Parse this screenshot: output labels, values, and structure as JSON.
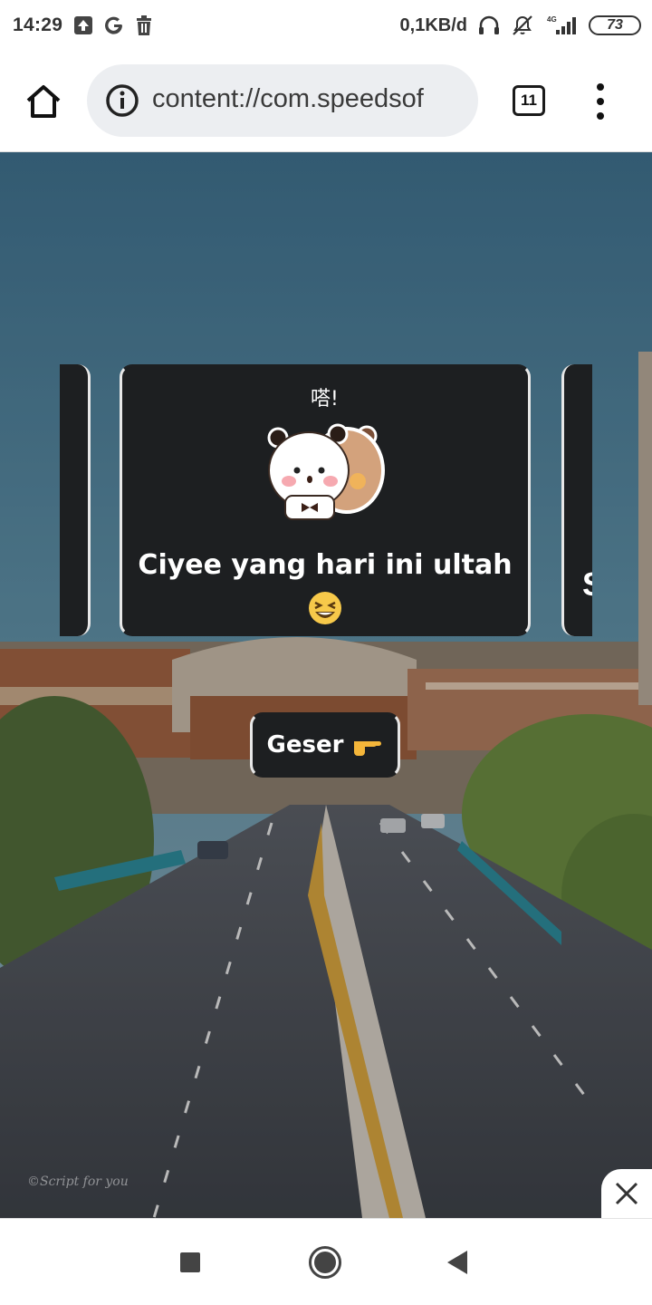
{
  "status_bar": {
    "time": "14:29",
    "left_icons": [
      "upload-icon",
      "google-icon",
      "trash-icon"
    ],
    "net_speed": "0,1KB/d",
    "right_icons": [
      "headphones-icon",
      "mute-vibrate-icon",
      "signal-4g-icon"
    ],
    "network_type": "4G",
    "battery": "73"
  },
  "browser": {
    "home_icon": "home-icon",
    "url": "content://com.speedsof",
    "tab_count": "11",
    "menu_icon": "more-vert-icon"
  },
  "page": {
    "background": "city-road-photo",
    "card_text": "Ciyee yang hari ini ultah",
    "card_emoji": "laughing-emoji",
    "sticker_text": "嗒!",
    "next_card_peek": "S",
    "swipe_button_label": "Geser",
    "swipe_button_icon": "pointing-right-hand-icon",
    "credit": "©Script for you",
    "card_color": "#1d1f21"
  },
  "nav_bar": {
    "buttons": [
      "recents-button",
      "home-button",
      "back-button"
    ]
  }
}
